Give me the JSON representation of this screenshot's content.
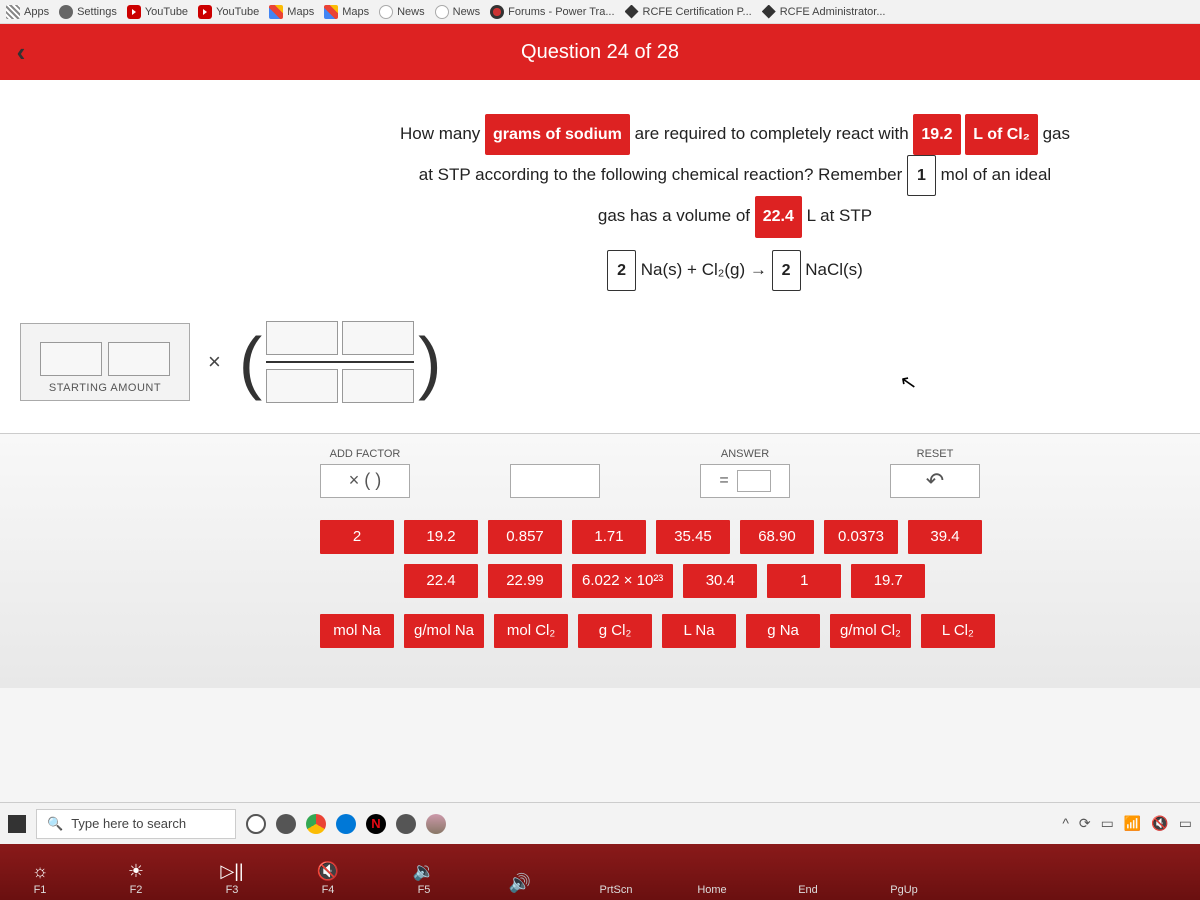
{
  "bookmarks": [
    {
      "label": "Apps",
      "icon": "apps"
    },
    {
      "label": "Settings",
      "icon": "gear"
    },
    {
      "label": "YouTube",
      "icon": "yt"
    },
    {
      "label": "YouTube",
      "icon": "yt"
    },
    {
      "label": "Maps",
      "icon": "maps"
    },
    {
      "label": "Maps",
      "icon": "maps"
    },
    {
      "label": "News",
      "icon": "news"
    },
    {
      "label": "News",
      "icon": "news"
    },
    {
      "label": "Forums - Power Tra...",
      "icon": "forum"
    },
    {
      "label": "RCFE Certification P...",
      "icon": "rcfe"
    },
    {
      "label": "RCFE Administrator...",
      "icon": "rcfe"
    }
  ],
  "header": {
    "title": "Question 24 of 28"
  },
  "question": {
    "t1": "How many ",
    "chip1": "grams of sodium",
    "t2": " are required to completely react with ",
    "chip2": "19.2",
    "chip3": "L of Cl₂",
    "t3": " gas",
    "t4": "at STP according to the following chemical reaction? Remember ",
    "chip4": "1",
    "t5": " mol of an ideal",
    "t6": "gas has a volume of ",
    "chip5": "22.4",
    "t7": " L at STP",
    "eq_coef1": "2",
    "eq_mid": " Na(s) + Cl₂(g) → ",
    "eq_coef2": "2",
    "eq_end": " NaCl(s)"
  },
  "start": {
    "label": "STARTING AMOUNT",
    "times": "×"
  },
  "controls": {
    "addFactorLabel": "ADD FACTOR",
    "addFactorSymbol": "× ( )",
    "answerLabel": "ANSWER",
    "eq": "=",
    "resetLabel": "RESET",
    "resetSymbol": "↶"
  },
  "tiles_row1": [
    "2",
    "19.2",
    "0.857",
    "1.71",
    "35.45",
    "68.90",
    "0.0373",
    "39.4"
  ],
  "tiles_row2": [
    "22.4",
    "22.99",
    "6.022 × 10²³",
    "30.4",
    "1",
    "19.7"
  ],
  "tiles_row3": [
    "mol Na",
    "g/mol Na",
    "mol Cl₂",
    "g Cl₂",
    "L Na",
    "g Na",
    "g/mol Cl₂",
    "L Cl₂"
  ],
  "taskbar": {
    "search_placeholder": "Type here to search"
  },
  "keys": [
    {
      "glyph": "☼",
      "label": "F1"
    },
    {
      "glyph": "☀",
      "label": "F2"
    },
    {
      "glyph": "▷||",
      "label": "F3"
    },
    {
      "glyph": "🔇",
      "label": "F4"
    },
    {
      "glyph": "🔉",
      "label": "F5"
    },
    {
      "glyph": "🔊",
      "label": ""
    },
    {
      "glyph": "",
      "label": "PrtScn"
    },
    {
      "glyph": "",
      "label": "Home"
    },
    {
      "glyph": "",
      "label": "End"
    },
    {
      "glyph": "",
      "label": "PgUp"
    }
  ]
}
